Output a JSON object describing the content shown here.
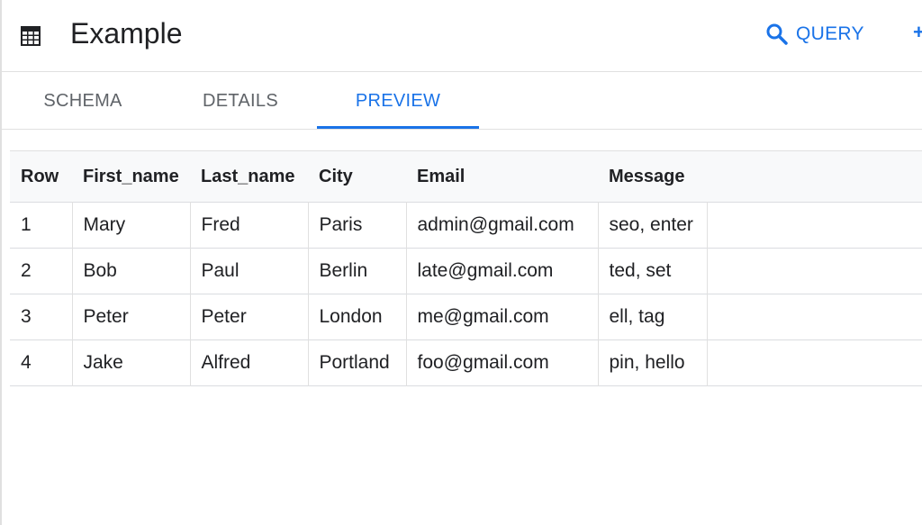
{
  "header": {
    "title": "Example",
    "table_icon": "table-grid-icon",
    "query_label": "QUERY",
    "query_icon": "search-icon",
    "more_icon": "plus-icon"
  },
  "tabs": [
    {
      "label": "SCHEMA",
      "active": false
    },
    {
      "label": "DETAILS",
      "active": false
    },
    {
      "label": "PREVIEW",
      "active": true
    }
  ],
  "colors": {
    "accent": "#1a73e8",
    "tab_inactive": "#5f6368",
    "border": "#e0e0e0"
  },
  "table": {
    "columns": [
      "Row",
      "First_name",
      "Last_name",
      "City",
      "Email",
      "Message"
    ],
    "rows": [
      [
        "1",
        "Mary",
        "Fred",
        "Paris",
        "admin@gmail.com",
        "seo, enter"
      ],
      [
        "2",
        "Bob",
        "Paul",
        "Berlin",
        "late@gmail.com",
        "ted, set"
      ],
      [
        "3",
        "Peter",
        "Peter",
        "London",
        "me@gmail.com",
        "ell, tag"
      ],
      [
        "4",
        "Jake",
        "Alfred",
        "Portland",
        "foo@gmail.com",
        "pin, hello"
      ]
    ]
  }
}
